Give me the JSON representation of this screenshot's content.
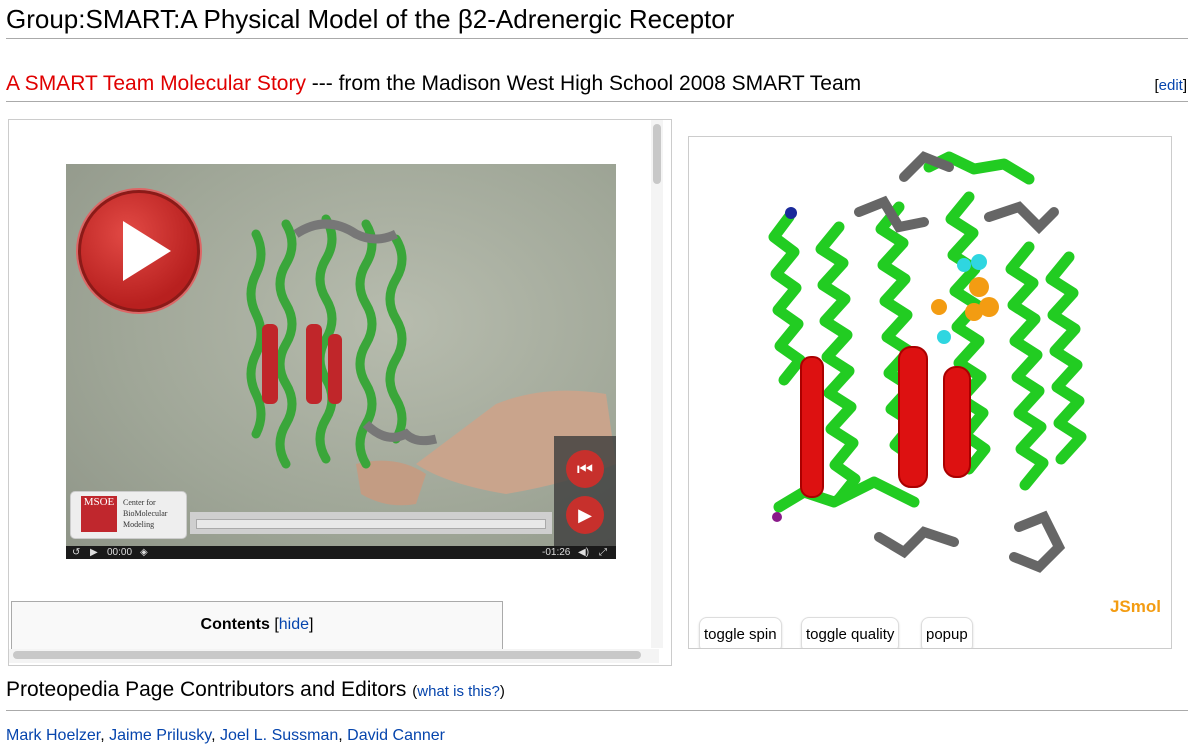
{
  "page": {
    "title": "Group:SMART:A Physical Model of the β2-Adrenergic Receptor"
  },
  "section": {
    "link_text": "A SMART Team Molecular Story",
    "rest_text": " --- from the Madison West High School 2008 SMART Team",
    "edit_open": "[",
    "edit_label": "edit",
    "edit_close": "]"
  },
  "video": {
    "time_current": "00:00",
    "time_remaining": "-01:26",
    "logo_mark": "MSOE",
    "logo_text": "Center for BioMolecular Modeling"
  },
  "toc": {
    "title": "Contents",
    "hide_open": "[",
    "hide_label": "hide",
    "hide_close": "]"
  },
  "viewer": {
    "brand": "JSmol",
    "buttons": [
      "toggle spin",
      "toggle quality",
      "popup"
    ]
  },
  "contributors": {
    "heading": "Proteopedia Page Contributors and Editors",
    "what_open": "(",
    "what_label": "what is this?",
    "what_close": ")",
    "names": [
      "Mark Hoelzer",
      "Jaime Prilusky",
      "Joel L. Sussman",
      "David Canner"
    ],
    "separator": ", "
  },
  "colors": {
    "link_red": "#e00000",
    "link_blue": "#0645ad",
    "helix": "#22cc22",
    "ligand": "#dd1111",
    "jsmol": "#f39c12"
  }
}
